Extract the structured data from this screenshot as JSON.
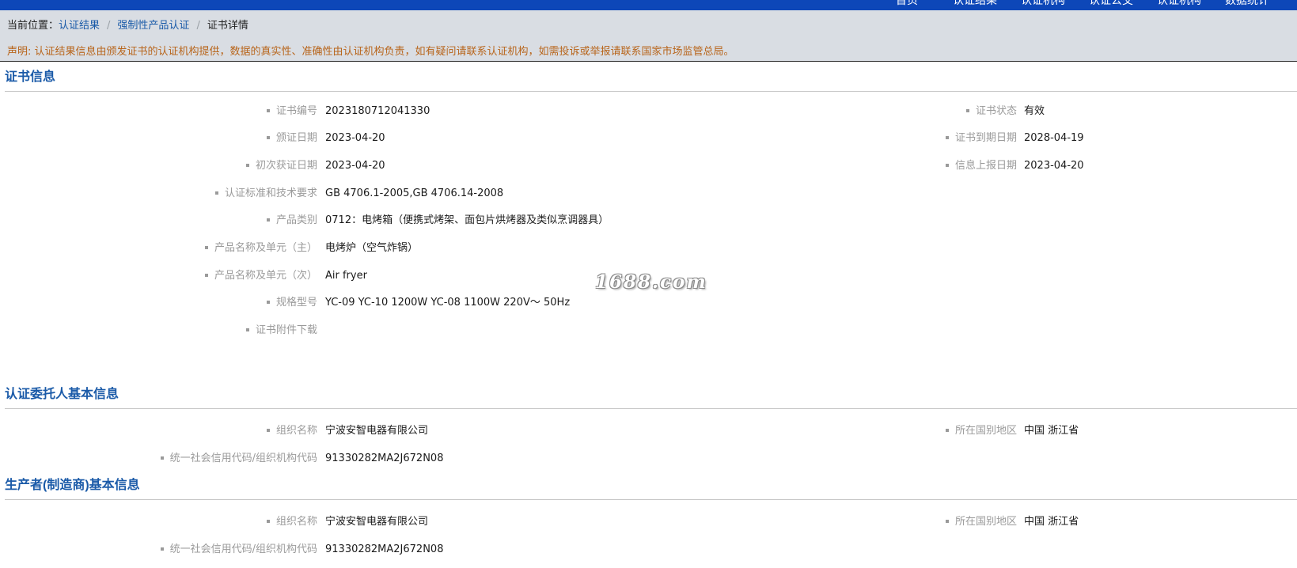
{
  "top_nav": [
    "首页",
    "认证结果",
    "认证机构",
    "认证公交",
    "认证机构",
    "数据统计"
  ],
  "breadcrumb": {
    "prefix": "当前位置：",
    "items": [
      "认证结果",
      "强制性产品认证",
      "证书详情"
    ],
    "separator": "/"
  },
  "notice": "声明: 认证结果信息由颁发证书的认证机构提供，数据的真实性、准确性由认证机构负责，如有疑问请联系认证机构，如需投诉或举报请联系国家市场监管总局。",
  "sections": {
    "certificate": {
      "title": "证书信息",
      "fields": [
        {
          "label": "证书编号",
          "value": "2023180712041330"
        },
        {
          "label": "颁证日期",
          "value": "2023-04-20"
        },
        {
          "label": "初次获证日期",
          "value": "2023-04-20"
        },
        {
          "label": "认证标准和技术要求",
          "value": "GB 4706.1-2005,GB 4706.14-2008"
        },
        {
          "label": "产品类别",
          "value": "0712：电烤箱（便携式烤架、面包片烘烤器及类似烹调器具）"
        },
        {
          "label": "产品名称及单元（主）",
          "value": "电烤炉（空气炸锅）"
        },
        {
          "label": "产品名称及单元（次）",
          "value": "Air fryer"
        },
        {
          "label": "规格型号",
          "value": "YC-09 YC-10 1200W YC-08 1100W 220V～ 50Hz"
        },
        {
          "label": "证书附件下载",
          "value": ""
        }
      ],
      "right_fields": [
        {
          "label": "证书状态",
          "value": "有效"
        },
        {
          "label": "证书到期日期",
          "value": "2028-04-19"
        },
        {
          "label": "信息上报日期",
          "value": "2023-04-20"
        }
      ]
    },
    "applicant": {
      "title": "认证委托人基本信息",
      "fields": [
        {
          "label": "组织名称",
          "value": "宁波安智电器有限公司"
        },
        {
          "label": "统一社会信用代码/组织机构代码",
          "value": "91330282MA2J672N08"
        }
      ],
      "right_fields": [
        {
          "label": "所在国别地区",
          "value": "中国 浙江省"
        }
      ]
    },
    "manufacturer": {
      "title": "生产者(制造商)基本信息",
      "fields": [
        {
          "label": "组织名称",
          "value": "宁波安智电器有限公司"
        },
        {
          "label": "统一社会信用代码/组织机构代码",
          "value": "91330282MA2J672N08"
        }
      ],
      "right_fields": [
        {
          "label": "所在国别地区",
          "value": "中国 浙江省"
        }
      ]
    }
  },
  "watermark": "1688.com",
  "colors": {
    "top_bar": "#0d47b8",
    "breadcrumb_bg": "#d9dde3",
    "link": "#1a5aa8",
    "notice": "#b8651b",
    "section_title": "#1a5aa8",
    "label": "#9a9a9a"
  }
}
